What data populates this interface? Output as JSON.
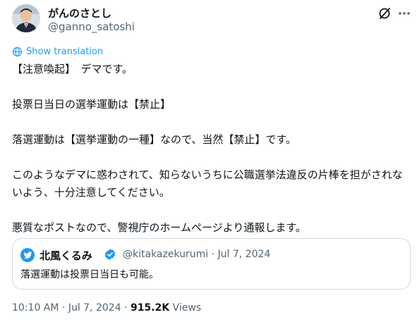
{
  "author": {
    "display_name": "がんのさとし",
    "handle": "@ganno_satoshi"
  },
  "icons": {
    "grok": "grok-slash-icon",
    "more": "more-options-icon",
    "translate": "globe-icon",
    "quote_avatar": "twitter-bird-icon",
    "verified": "verified-badge-icon"
  },
  "translate_label": "Show translation",
  "tweet": {
    "paragraphs": [
      "【注意喚起】　デマです。",
      "投票日当日の選挙運動は【禁止】",
      "落選運動は【選挙運動の一種】なので、当然【禁止】です。",
      "このようなデマに惑わされて、知らないうちに公職選挙法違反の片棒を担がされないよう、十分注意してください。",
      "悪質なポストなので、警視庁のホームページより通報します。"
    ]
  },
  "quote": {
    "display_name": "北風くるみ",
    "handle": "@kitakazekurumi",
    "separator": "·",
    "date": "Jul 7, 2024",
    "text": "落選運動は投票日当日も可能。"
  },
  "footer": {
    "time": "10:10 AM",
    "separator": "·",
    "date": "Jul 7, 2024",
    "views_count": "915.2K",
    "views_label": "Views"
  },
  "colors": {
    "accent": "#1d9bf0",
    "text": "#0f1419",
    "muted": "#536471",
    "border": "#cfd9de"
  }
}
